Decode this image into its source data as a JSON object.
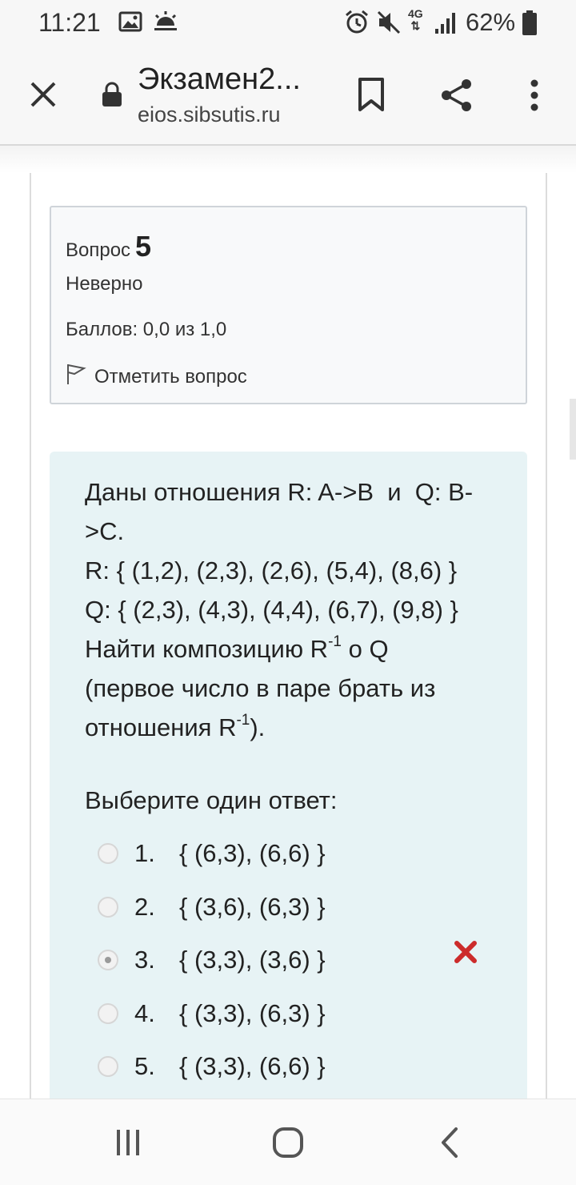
{
  "status_bar": {
    "time": "11:21",
    "battery_percent": "62%",
    "network_label": "4G",
    "icons": [
      "image-icon",
      "weather-icon",
      "alarm-icon",
      "mute-icon",
      "network-4g-icon",
      "signal-icon",
      "battery-icon"
    ]
  },
  "browser": {
    "page_title": "Экзамен2...",
    "url": "eios.sibsutis.ru",
    "icons": [
      "close-icon",
      "lock-icon",
      "bookmark-icon",
      "share-icon",
      "more-icon"
    ]
  },
  "question_info": {
    "label": "Вопрос",
    "number": "5",
    "state": "Неверно",
    "grade": "Баллов: 0,0 из 1,0",
    "flag_label": "Отметить вопрос"
  },
  "question": {
    "line1": "Даны отношения R: A->B  и  Q: B-",
    "line2": ">C.",
    "line3": "R: { (1,2), (2,3), (2,6), (5,4), (8,6) }",
    "line4": "Q: { (2,3), (4,3), (4,4), (6,7), (9,8) }",
    "line5_prefix": "Найти композицию R",
    "line5_sup": "-1",
    "line5_suffix": " o Q",
    "line6": "(первое число в паре брать из",
    "line7_prefix": "отношения R",
    "line7_sup": "-1",
    "line7_suffix": ")."
  },
  "answer": {
    "prompt": "Выберите один ответ:",
    "options": [
      {
        "num": "1.",
        "text": "{ (6,3), (6,6) }",
        "selected": false
      },
      {
        "num": "2.",
        "text": "{ (3,6), (6,3) }",
        "selected": false
      },
      {
        "num": "3.",
        "text": "{ (3,3), (3,6) }",
        "selected": true,
        "marked_incorrect": true
      },
      {
        "num": "4.",
        "text": "{ (3,3), (6,3) }",
        "selected": false
      },
      {
        "num": "5.",
        "text": "{ (3,3), (6,6) }",
        "selected": false
      }
    ],
    "incorrect_color": "#cc2b2b"
  },
  "navbar": {
    "icons": [
      "recent-apps-icon",
      "home-icon",
      "back-icon"
    ]
  },
  "colors": {
    "content_bg": "#e7f3f5",
    "info_bg": "#f8f9fa"
  }
}
